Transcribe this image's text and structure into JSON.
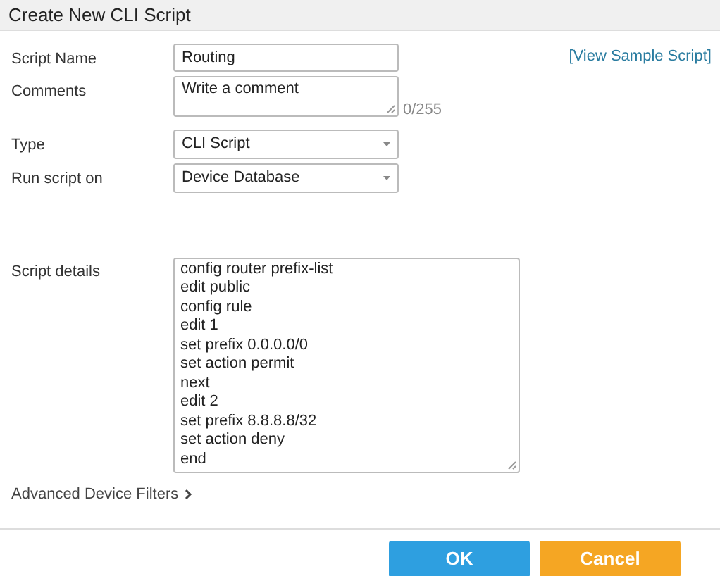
{
  "window": {
    "title": "Create New CLI Script"
  },
  "link": "[View Sample Script]",
  "fields": [
    {
      "kind": "input",
      "label": "Script Name",
      "value": "Routing"
    },
    {
      "kind": "textarea",
      "label": "Comments",
      "placeholder": "Write a comment",
      "counter": "0/255"
    },
    {
      "kind": "select",
      "label": "Type",
      "value": "CLI Script"
    },
    {
      "kind": "select",
      "label": "Run script on",
      "value": "Device Database"
    }
  ],
  "script_details": {
    "label": "Script details",
    "lines": [
      "config router prefix-list",
      "edit public",
      "config rule",
      "edit 1",
      "set prefix 0.0.0.0/0",
      "set action permit",
      "next",
      "edit 2",
      "set prefix 8.8.8.8/32",
      "set action deny",
      "end"
    ]
  },
  "advanced": {
    "label": "Advanced Device Filters",
    "expanded": false
  },
  "buttons": [
    {
      "kind": "primary",
      "label": "OK"
    },
    {
      "kind": "cancel",
      "label": "Cancel"
    }
  ]
}
